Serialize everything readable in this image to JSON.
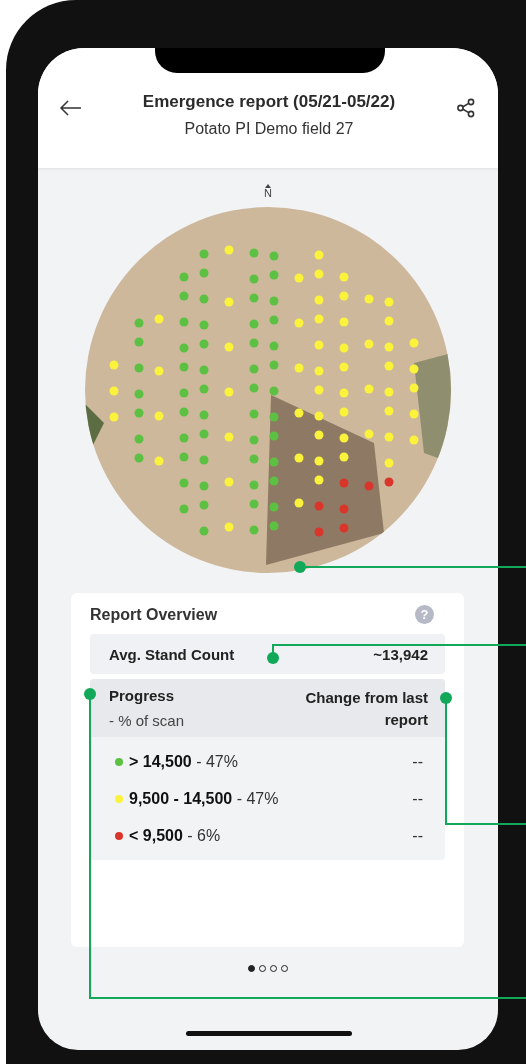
{
  "header": {
    "title": "Emergence report (05/21-05/22)",
    "subtitle": "Potato PI Demo field 27"
  },
  "map": {
    "north_label": "N"
  },
  "overview": {
    "title": "Report Overview",
    "help_icon": "?",
    "avg": {
      "label": "Avg. Stand Count",
      "value": "~13,942"
    },
    "progress": {
      "title": "Progress",
      "subtitle": "- % of scan",
      "change_header": "Change from last report",
      "rows": [
        {
          "label": "**> 14,500** - 47%",
          "change": "--",
          "color": "#5cc142"
        },
        {
          "label": "**9,500 - 14,500** - 47%",
          "change": "--",
          "color": "#fbf23c"
        },
        {
          "label": "**< 9,500** - 6%",
          "change": "--",
          "color": "#d9352a"
        }
      ]
    }
  },
  "pager": [
    {
      "selected": true
    },
    {
      "selected": false
    },
    {
      "selected": false
    },
    {
      "selected": false
    }
  ]
}
